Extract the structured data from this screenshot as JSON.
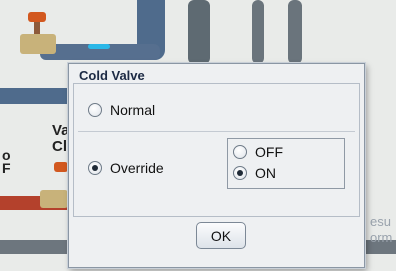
{
  "background": {
    "label_left_top": "Va",
    "label_left_bottom": "Cl",
    "label_edge_top": "o",
    "label_edge_bottom": "F",
    "label_right_top": "esu",
    "label_right_bottom": "orm"
  },
  "dialog": {
    "title": "Cold Valve",
    "mode_options": [
      {
        "label": "Normal",
        "checked": false
      },
      {
        "label": "Override",
        "checked": true
      }
    ],
    "override_options": [
      {
        "label": "OFF",
        "checked": false
      },
      {
        "label": "ON",
        "checked": true
      }
    ],
    "ok_label": "OK"
  },
  "colors": {
    "pipe_blue": "#4f6b8c",
    "pipe_gray": "#5e6a72",
    "pipe_red": "#b4412c",
    "valve_orange": "#d2581f",
    "fitting_tan": "#c8b27a",
    "accent_cyan": "#2bb8e8"
  },
  "icons": [
    "radio-button-icon",
    "valve-icon"
  ]
}
